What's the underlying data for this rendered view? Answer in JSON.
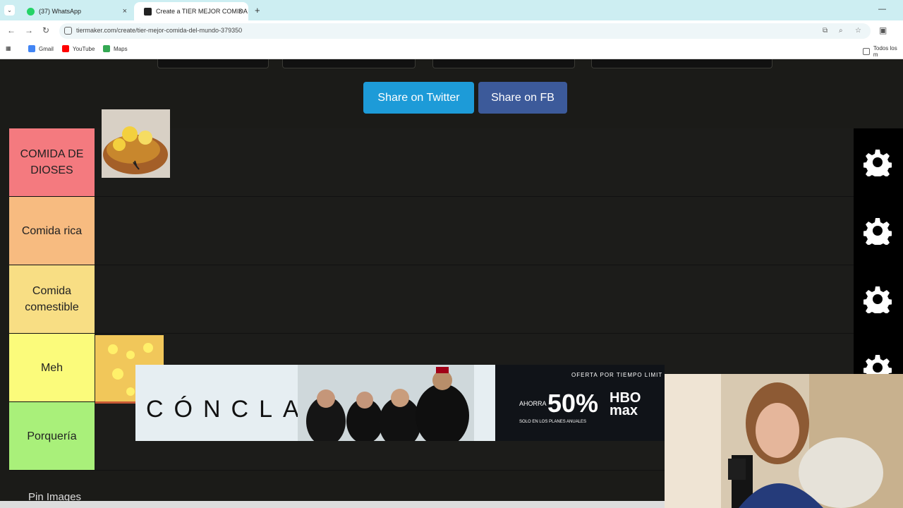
{
  "browser": {
    "tabs": [
      {
        "label": "(37) WhatsApp",
        "active": false
      },
      {
        "label": "Create a TIER MEJOR COMIDA",
        "active": true
      }
    ],
    "url": "tiermaker.com/create/tier-mejor-comida-del-mundo-379350",
    "bookmarks": [
      "Gmail",
      "YouTube",
      "Maps"
    ],
    "all_bookmarks_label": "Todos los m"
  },
  "share": {
    "twitter_label": "Share on Twitter",
    "facebook_label": "Share on FB"
  },
  "tiers": [
    {
      "label": "COMIDA DE DIOSES",
      "color": "#f47a7f"
    },
    {
      "label": "Comida rica",
      "color": "#f7bb80"
    },
    {
      "label": "Comida comestible",
      "color": "#f8de84"
    },
    {
      "label": "Meh",
      "color": "#fbfb7b"
    },
    {
      "label": "Porquería",
      "color": "#a9f07a"
    }
  ],
  "bottom_label": "Pin Images",
  "ad": {
    "movie_title": "CÓNCLAVE",
    "offer_label": "OFERTA POR TIEMPO LIMIT",
    "save_label": "AHORRA",
    "percent": "50%",
    "plans_label": "SOLO EN LOS PLANES ANUALES",
    "brand": "HBO max"
  }
}
